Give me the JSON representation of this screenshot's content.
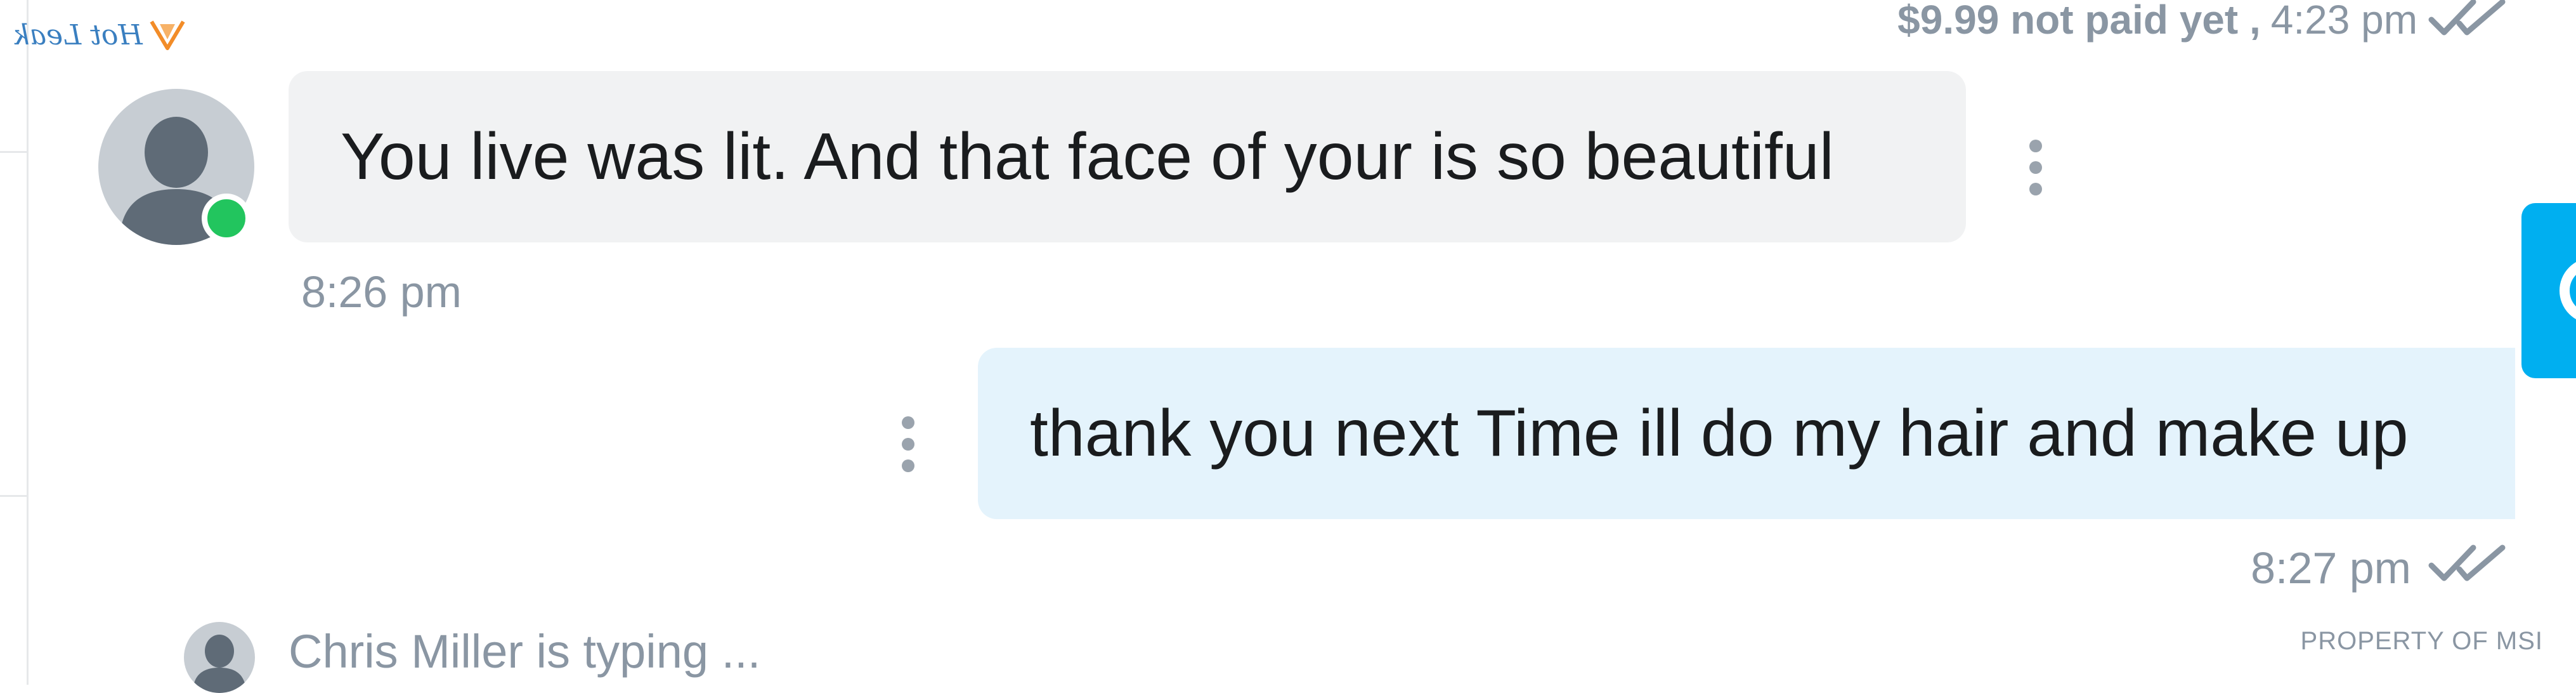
{
  "logo": {
    "text": "Hot Leak",
    "icon": "flame-logo-icon"
  },
  "top_status": {
    "price_status": "$9.99 not paid yet ,",
    "time": "4:23 pm",
    "read_icon": "double-check-icon"
  },
  "messages": [
    {
      "direction": "incoming",
      "text": "You live was lit. And that face of your is so beautiful",
      "time": "8:26 pm",
      "sender_online": true
    },
    {
      "direction": "outgoing",
      "text": "thank you next Time ill do my hair and make up",
      "time": "8:27 pm",
      "read_icon": "double-check-icon"
    }
  ],
  "typing_indicator": {
    "text": "Chris Miller is typing ..."
  },
  "watermark": "PROPERTY OF MSI",
  "colors": {
    "incoming_bubble": "#f1f2f3",
    "outgoing_bubble": "#e4f3fc",
    "online": "#22c55e",
    "accent": "#00aff0",
    "muted_text": "#8a96a3"
  }
}
